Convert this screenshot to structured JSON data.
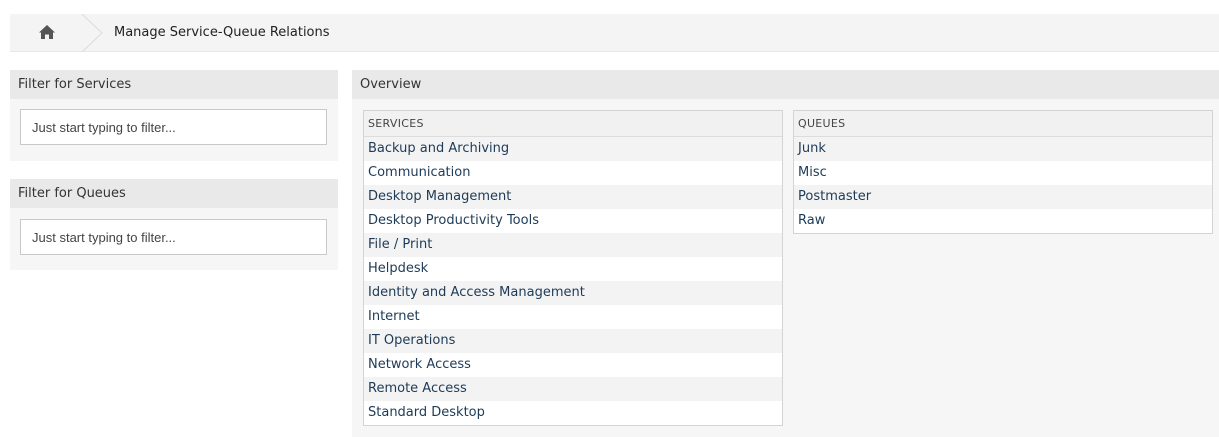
{
  "breadcrumb": {
    "home_icon": "home-icon",
    "title": "Manage Service-Queue Relations"
  },
  "filter_services": {
    "title": "Filter for Services",
    "placeholder": "Just start typing to filter..."
  },
  "filter_queues": {
    "title": "Filter for Queues",
    "placeholder": "Just start typing to filter..."
  },
  "overview": {
    "title": "Overview",
    "services": {
      "header": "SERVICES",
      "items": [
        "Backup and Archiving",
        "Communication",
        "Desktop Management",
        "Desktop Productivity Tools",
        "File / Print",
        "Helpdesk",
        "Identity and Access Management",
        "Internet",
        "IT Operations",
        "Network Access",
        "Remote Access",
        "Standard Desktop"
      ]
    },
    "queues": {
      "header": "QUEUES",
      "items": [
        "Junk",
        "Misc",
        "Postmaster",
        "Raw"
      ]
    }
  },
  "colors": {
    "header_bg": "#e9e9e9",
    "body_bg": "#f6f6f6",
    "link": "#1d3b57"
  }
}
